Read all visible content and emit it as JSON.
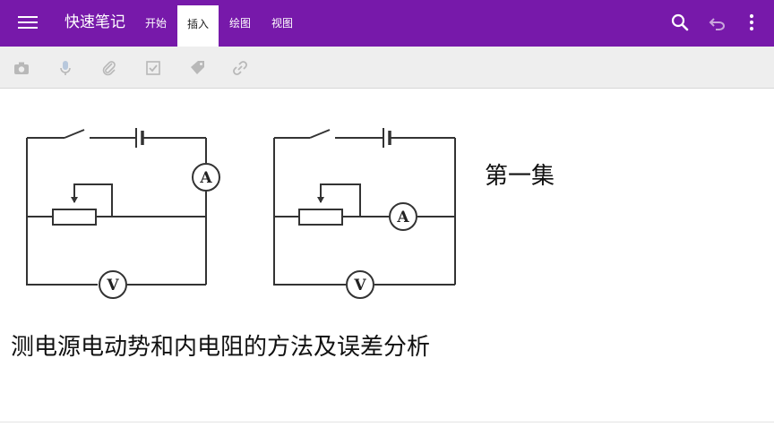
{
  "app": {
    "title": "快速笔记"
  },
  "tabs": [
    {
      "label": "开始"
    },
    {
      "label": "插入"
    },
    {
      "label": "绘图"
    },
    {
      "label": "视图"
    }
  ],
  "active_tab": "插入",
  "right_icons": [
    "search-icon",
    "undo-icon",
    "more-vert-icon"
  ],
  "toolbar": {
    "icons": [
      "camera-icon",
      "microphone-icon",
      "attach-icon",
      "checkbox-icon",
      "tag-icon",
      "link-icon"
    ]
  },
  "note": {
    "circuit1": {
      "ammeter_label": "A",
      "voltmeter_label": "V"
    },
    "circuit2": {
      "ammeter_label": "A",
      "voltmeter_label": "V"
    },
    "side_text": "第一集",
    "main_text": "测电源电动势和内电阻的方法及误差分析"
  },
  "colors": {
    "accent": "#7719aa",
    "toolbar_bg": "#eeeeee",
    "icon_disabled": "#b8b8b8"
  }
}
